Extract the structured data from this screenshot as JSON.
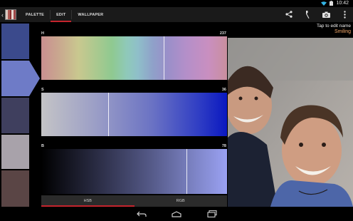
{
  "status_bar": {
    "time": "10:42",
    "icons": [
      "wifi-icon",
      "battery-icon"
    ]
  },
  "action_bar": {
    "app_icon": "palette-swatches-icon",
    "tabs": [
      {
        "label": "PALETTE",
        "active": false
      },
      {
        "label": "EDIT",
        "active": true
      },
      {
        "label": "WALLPAPER",
        "active": false
      }
    ],
    "actions": [
      "share-icon",
      "eyedropper-icon",
      "camera-icon",
      "overflow-menu-icon"
    ],
    "accent_color": "#c4242d"
  },
  "palette": {
    "swatches": [
      "#3b4a8c",
      "#6e7bc7",
      "#3f3f5e",
      "#a8a2aa",
      "#5a4545"
    ],
    "selected_index": 1
  },
  "sliders": [
    {
      "label": "H",
      "value": "237",
      "fraction": 0.658
    },
    {
      "label": "S",
      "value": "36",
      "fraction": 0.36
    },
    {
      "label": "B",
      "value": "78",
      "fraction": 0.78
    }
  ],
  "color_modes": [
    {
      "label": "HSB",
      "active": true
    },
    {
      "label": "RGB",
      "active": false
    }
  ],
  "photo": {
    "tap_hint": "Tap to edit name",
    "color_name": "Smiling",
    "name_color": "#f4a86a"
  },
  "nav_bar": {
    "buttons": [
      "back-icon",
      "home-icon",
      "recent-apps-icon"
    ]
  }
}
